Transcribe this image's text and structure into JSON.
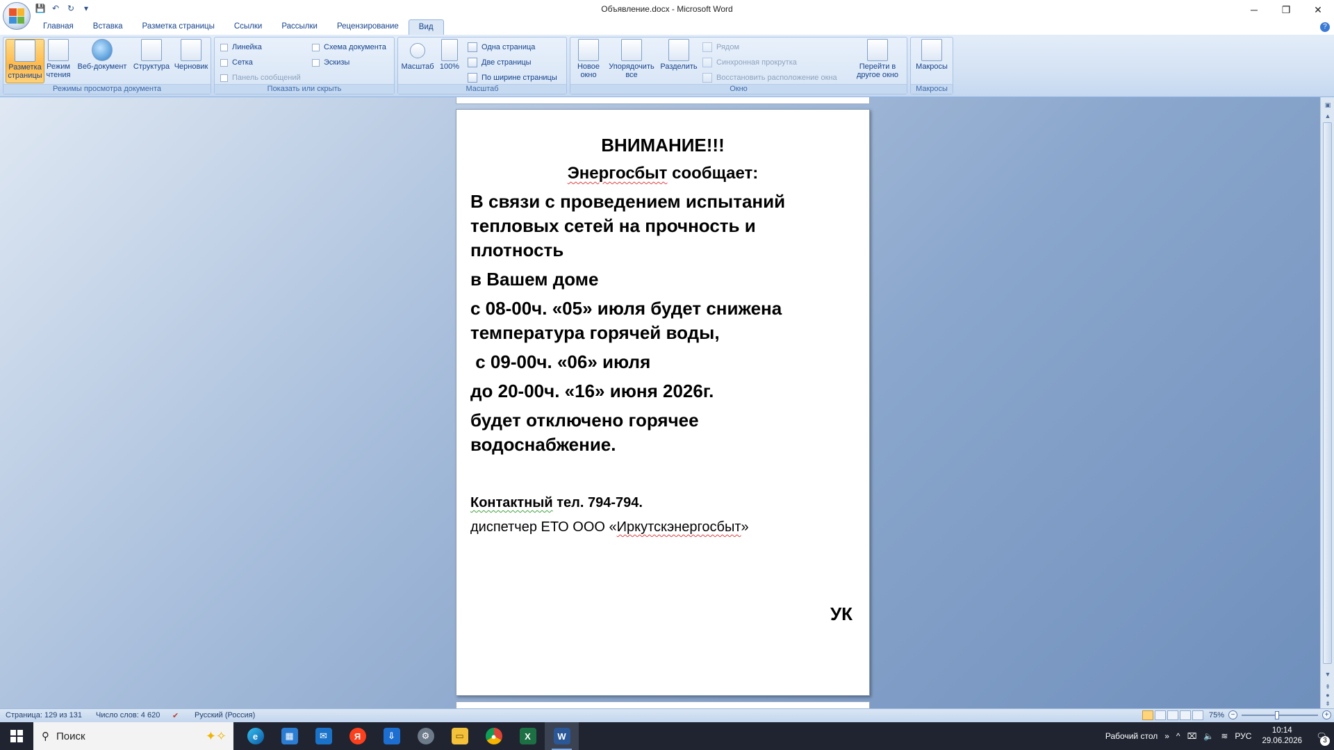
{
  "window": {
    "title": "Объявление.docx - Microsoft Word",
    "minimize": "─",
    "restore": "❐",
    "close": "✕"
  },
  "qat": {
    "save": "💾",
    "undo": "↶",
    "redo": "↻",
    "more": "▾"
  },
  "tabs": [
    {
      "label": "Главная"
    },
    {
      "label": "Вставка"
    },
    {
      "label": "Разметка страницы"
    },
    {
      "label": "Ссылки"
    },
    {
      "label": "Рассылки"
    },
    {
      "label": "Рецензирование"
    },
    {
      "label": "Вид"
    }
  ],
  "ribbon": {
    "views": {
      "label": "Режимы просмотра документа",
      "print_layout": "Разметка страницы",
      "reading": "Режим чтения",
      "web": "Веб-документ",
      "outline": "Структура",
      "draft": "Черновик"
    },
    "show": {
      "label": "Показать или скрыть",
      "ruler": "Линейка",
      "grid": "Сетка",
      "message_bar": "Панель сообщений",
      "doc_map": "Схема документа",
      "thumbnails": "Эскизы"
    },
    "zoom": {
      "label": "Масштаб",
      "zoom": "Масштаб",
      "hundred": "100%",
      "one_page": "Одна страница",
      "two_pages": "Две страницы",
      "page_width": "По ширине страницы"
    },
    "window": {
      "label": "Окно",
      "new_window": "Новое окно",
      "arrange_all": "Упорядочить все",
      "split": "Разделить",
      "side_by_side": "Рядом",
      "sync_scroll": "Синхронная прокрутка",
      "reset_position": "Восстановить расположение окна",
      "switch_windows": "Перейти в другое окно"
    },
    "macros": {
      "label": "Макросы",
      "macros": "Макросы"
    }
  },
  "document": {
    "attention": "ВНИМАНИЕ!!!",
    "company": "Энергосбыт",
    "reports": " сообщает:",
    "para1_l1": "В связи с проведением испытаний",
    "para1_l2": "тепловых сетей на прочность и",
    "para1_l3": "плотность",
    "para2": "в Вашем доме",
    "para3_l1": "с 08-00ч. «05» июля будет снижена",
    "para3_l2": "температура горячей воды,",
    "para4": " с 09-00ч. «06» июля",
    "para5": "до 20-00ч. «16» июня 2026г.",
    "para6_l1": "будет отключено горячее",
    "para6_l2": "водоснабжение.",
    "contact_word": "Контактный",
    "contact_rest": " тел. 794-794.",
    "dispatcher_pre": "диспетчер ЕТО ООО «",
    "dispatcher_org": "Иркутскэнергосбыт",
    "dispatcher_post": "»",
    "signature": "УК"
  },
  "statusbar": {
    "page": "Страница: 129 из 131",
    "words": "Число слов: 4 620",
    "language": "Русский (Россия)",
    "zoom": "75%"
  },
  "taskbar": {
    "search_placeholder": "Поиск",
    "desktop": "Рабочий стол",
    "lang": "РУС",
    "time": "10:14",
    "date": "29.06.2026",
    "notifications": "3"
  }
}
